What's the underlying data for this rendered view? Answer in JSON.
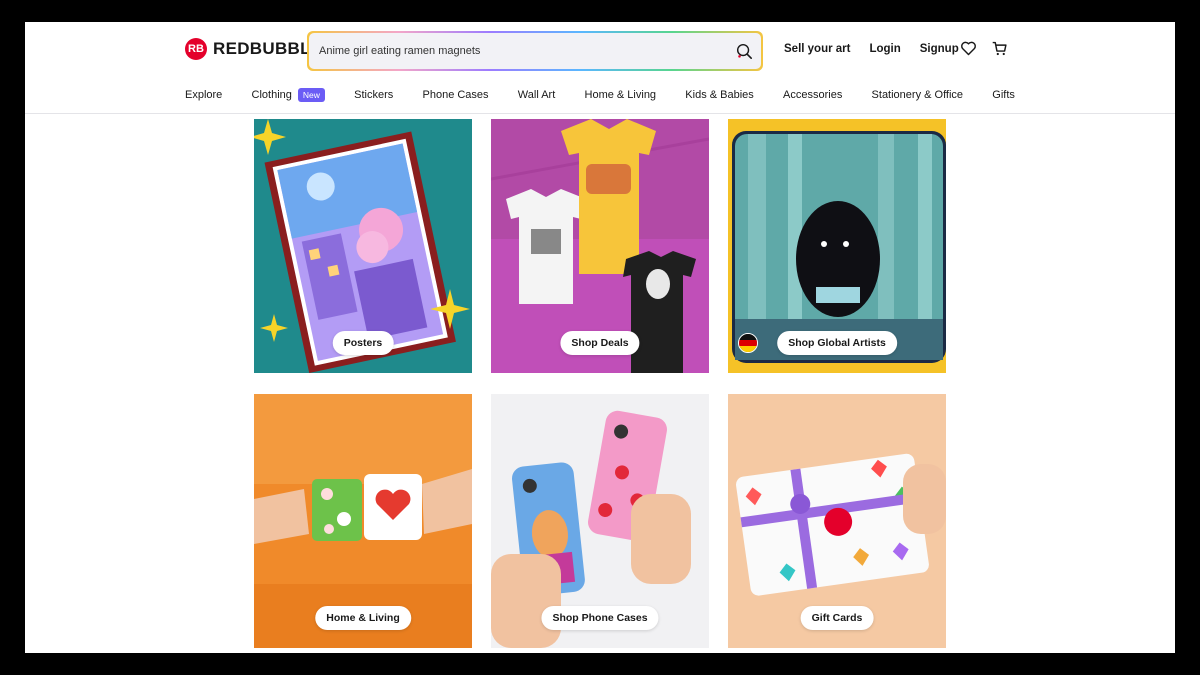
{
  "brand": {
    "name": "REDBUBBLE",
    "mark": "RB"
  },
  "search": {
    "value": "Anime girl eating ramen magnets"
  },
  "header_links": [
    "Sell your art",
    "Login",
    "Signup"
  ],
  "icons": [
    "search-icon",
    "heart-icon",
    "cart-icon"
  ],
  "nav": {
    "items": [
      "Explore",
      "Clothing",
      "Stickers",
      "Phone Cases",
      "Wall Art",
      "Home & Living",
      "Kids & Babies",
      "Accessories",
      "Stationery & Office",
      "Gifts"
    ],
    "clothing_badge": "New"
  },
  "tiles": [
    {
      "label": "Posters",
      "bg": "#1f8a8c"
    },
    {
      "label": "Shop Deals",
      "bg": "#c04fb8"
    },
    {
      "label": "Shop Global Artists",
      "bg": "#f5c227"
    },
    {
      "label": "Home & Living",
      "bg": "#f08a2a"
    },
    {
      "label": "Shop Phone Cases",
      "bg": "#f1f1f3"
    },
    {
      "label": "Gift Cards",
      "bg": "#f5c9a3"
    }
  ],
  "colors": {
    "accent": "#e4002b",
    "badge": "#6b5cf5"
  }
}
